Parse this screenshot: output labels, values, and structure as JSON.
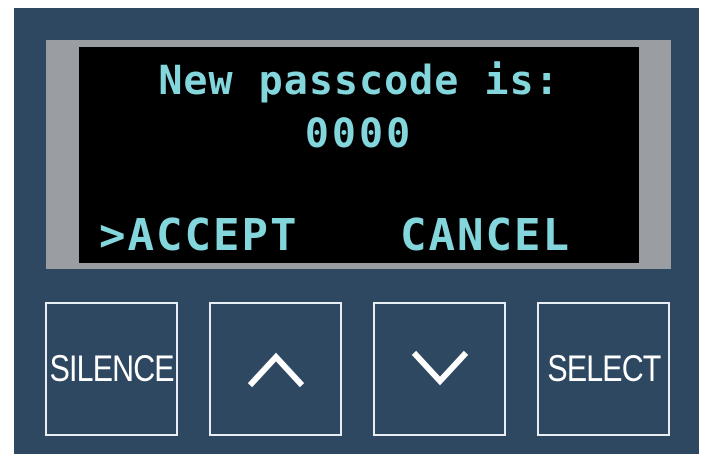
{
  "display": {
    "line1": "New passcode is:",
    "line2": "0000",
    "options": {
      "accept": ">ACCEPT",
      "cancel": "CANCEL"
    }
  },
  "buttons": {
    "silence": "SILENCE",
    "up_icon": "chevron-up-icon",
    "down_icon": "chevron-down-icon",
    "select": "SELECT"
  },
  "colors": {
    "panel": "#2e4862",
    "bezel": "#9a9ea2",
    "screen": "#000000",
    "lcd_text": "#83d6dc",
    "button_border": "#e8eef3"
  }
}
